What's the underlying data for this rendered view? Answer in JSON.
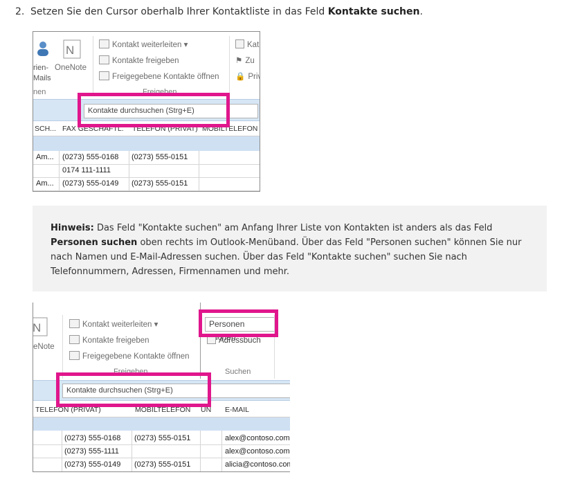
{
  "step": {
    "number": "2.",
    "text_before": "Setzen Sie den Cursor oberhalb Ihrer Kontaktliste in das Feld ",
    "bold": "Kontakte suchen",
    "text_after": "."
  },
  "shot1": {
    "partial_labels": {
      "mails_line1": "rien-",
      "mails_line2": "Mails",
      "onenote": "OneNote",
      "group_left": "nen",
      "kat": "Kat",
      "zu": "Zu",
      "priv": "Priv"
    },
    "ribbon": {
      "forward_label": "Kontakt weiterleiten",
      "share_label": "Kontakte freigeben",
      "open_shared_label": "Freigegebene Kontakte öffnen",
      "group_label": "Freigeben"
    },
    "search_placeholder": "Kontakte durchsuchen (Strg+E)",
    "columns": [
      "SCH...",
      "FAX GESCHÄFTL.",
      "TELEFON (PRIVAT)",
      "MOBILTELEFON"
    ],
    "rows": [
      [
        "Am...",
        "(0273) 555-0168",
        "(0273) 555-0151",
        ""
      ],
      [
        "",
        "0174 111-1111",
        "",
        ""
      ],
      [
        "Am...",
        "(0273) 555-0149",
        "(0273) 555-0151",
        ""
      ]
    ]
  },
  "note": {
    "label": "Hinweis:",
    "text1": " Das Feld \"Kontakte suchen\" am Anfang Ihrer Liste von Kontakten ist anders als das Feld ",
    "bold2": "Personen suchen",
    "text2": " oben rechts im Outlook-Menüband. Über das Feld \"Personen suchen\" können Sie nur nach Namen und E-Mail-Adressen suchen. Über das Feld \"Kontakte suchen\" suchen Sie nach Telefonnummern, Adressen, Firmennamen und mehr."
  },
  "shot2": {
    "partial_labels": {
      "onenote": "eNote"
    },
    "ribbon": {
      "forward_label": "Kontakt weiterleiten",
      "share_label": "Kontakte freigeben",
      "open_shared_label": "Freigegebene Kontakte öffnen",
      "group_label": "Freigeben",
      "people_search_label": "Personen suchen",
      "address_book_label": "Adressbuch",
      "search_group_label": "Suchen"
    },
    "search_placeholder": "Kontakte durchsuchen (Strg+E)",
    "columns": [
      "TELEFON (PRIVAT)",
      "MOBILTELEFON",
      "UN",
      "E-MAIL"
    ],
    "rows": [
      [
        "(0273) 555-0168",
        "(0273) 555-0151",
        "",
        "alex@contoso.com"
      ],
      [
        "(0273) 555-1111",
        "",
        "",
        "alex@contoso.com"
      ],
      [
        "(0273) 555-0149",
        "(0273) 555-0151",
        "",
        "alicia@contoso.com"
      ]
    ]
  },
  "colors": {
    "highlight": "#e0168c",
    "band": "#cfe0f3",
    "note_bg": "#f2f2f2"
  },
  "icons": [
    "contact-mail-icon",
    "onenote-icon",
    "forward-icon",
    "share-icon",
    "open-shared-icon",
    "categorize-icon",
    "flag-icon",
    "private-icon",
    "address-book-icon"
  ]
}
